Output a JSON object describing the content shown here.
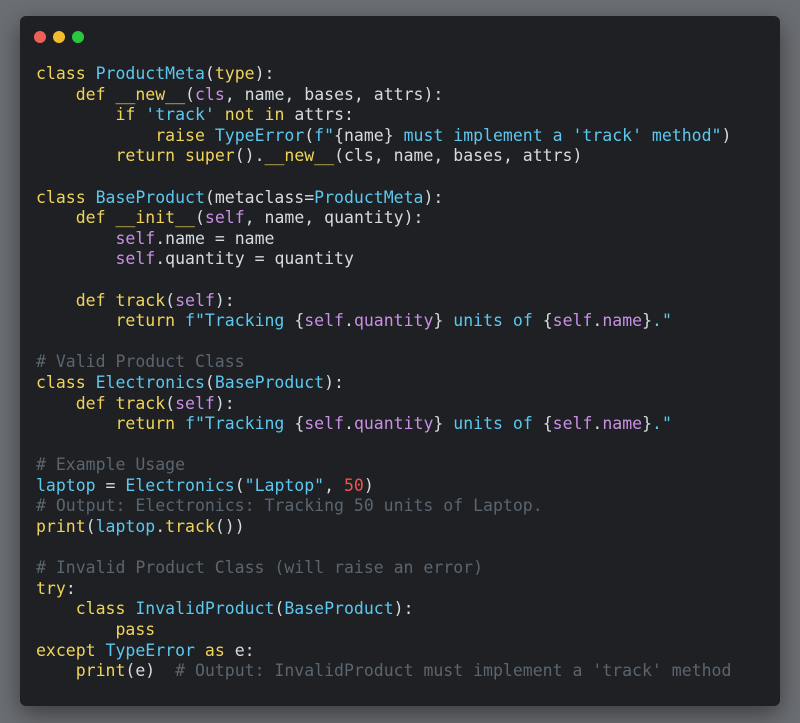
{
  "colors": {
    "background": "#6b6e73",
    "editor_bg": "#1e2023",
    "close": "#ee5f57",
    "minimize": "#f2bb2e",
    "maximize": "#28c840",
    "keyword": "#f0d45a",
    "class_name": "#5cc8f0",
    "function": "#f0d45a",
    "self": "#c990e6",
    "string": "#5cc8f0",
    "number": "#ef5350",
    "comment": "#5b6570",
    "plain": "#d6dbe0",
    "operator": "#7fd47a"
  },
  "window_controls": [
    {
      "name": "close-dot",
      "color": "#ee5f57"
    },
    {
      "name": "minimize-dot",
      "color": "#f2bb2e"
    },
    {
      "name": "maximize-dot",
      "color": "#28c840"
    }
  ],
  "code_lines": [
    [
      [
        "kw",
        "class"
      ],
      [
        "p",
        " "
      ],
      [
        "cls",
        "ProductMeta"
      ],
      [
        "p",
        "("
      ],
      [
        "kw",
        "type"
      ],
      [
        "p",
        "):"
      ]
    ],
    [
      [
        "p",
        "    "
      ],
      [
        "kw",
        "def"
      ],
      [
        "p",
        " "
      ],
      [
        "fn",
        "__new__"
      ],
      [
        "p",
        "("
      ],
      [
        "self",
        "cls"
      ],
      [
        "p",
        ", name, bases, attrs):"
      ]
    ],
    [
      [
        "p",
        "        "
      ],
      [
        "kw",
        "if"
      ],
      [
        "p",
        " "
      ],
      [
        "str",
        "'track'"
      ],
      [
        "p",
        " "
      ],
      [
        "kw",
        "not"
      ],
      [
        "p",
        " "
      ],
      [
        "kw",
        "in"
      ],
      [
        "p",
        " attrs:"
      ]
    ],
    [
      [
        "p",
        "            "
      ],
      [
        "kw",
        "raise"
      ],
      [
        "p",
        " "
      ],
      [
        "cls",
        "TypeError"
      ],
      [
        "p",
        "("
      ],
      [
        "str",
        "f\""
      ],
      [
        "p",
        "{name}"
      ],
      [
        "str",
        " must implement a 'track' method\""
      ],
      [
        "p",
        ")"
      ]
    ],
    [
      [
        "p",
        "        "
      ],
      [
        "kw",
        "return"
      ],
      [
        "p",
        " "
      ],
      [
        "fn",
        "super"
      ],
      [
        "p",
        "()."
      ],
      [
        "fn",
        "__new__"
      ],
      [
        "p",
        "(cls, name, bases, attrs)"
      ]
    ],
    [],
    [
      [
        "kw",
        "class"
      ],
      [
        "p",
        " "
      ],
      [
        "cls",
        "BaseProduct"
      ],
      [
        "p",
        "(metaclass="
      ],
      [
        "cls",
        "ProductMeta"
      ],
      [
        "p",
        "):"
      ]
    ],
    [
      [
        "p",
        "    "
      ],
      [
        "kw",
        "def"
      ],
      [
        "p",
        " "
      ],
      [
        "fn",
        "__init__"
      ],
      [
        "p",
        "("
      ],
      [
        "self",
        "self"
      ],
      [
        "p",
        ", name, quantity):"
      ]
    ],
    [
      [
        "p",
        "        "
      ],
      [
        "self",
        "self"
      ],
      [
        "p",
        ".name = name"
      ]
    ],
    [
      [
        "p",
        "        "
      ],
      [
        "self",
        "self"
      ],
      [
        "p",
        ".quantity = quantity"
      ]
    ],
    [],
    [
      [
        "p",
        "    "
      ],
      [
        "kw",
        "def"
      ],
      [
        "p",
        " "
      ],
      [
        "fn",
        "track"
      ],
      [
        "p",
        "("
      ],
      [
        "self",
        "self"
      ],
      [
        "p",
        "):"
      ]
    ],
    [
      [
        "p",
        "        "
      ],
      [
        "kw",
        "return"
      ],
      [
        "p",
        " "
      ],
      [
        "str",
        "f\"Tracking "
      ],
      [
        "p",
        "{"
      ],
      [
        "self",
        "self"
      ],
      [
        "p",
        "."
      ],
      [
        "self",
        "quantity"
      ],
      [
        "p",
        "}"
      ],
      [
        "str",
        " units of "
      ],
      [
        "p",
        "{"
      ],
      [
        "self",
        "self"
      ],
      [
        "p",
        "."
      ],
      [
        "self",
        "name"
      ],
      [
        "p",
        "}"
      ],
      [
        "str",
        ".\""
      ]
    ],
    [],
    [
      [
        "cm",
        "# Valid Product Class"
      ]
    ],
    [
      [
        "kw",
        "class"
      ],
      [
        "p",
        " "
      ],
      [
        "cls",
        "Electronics"
      ],
      [
        "p",
        "("
      ],
      [
        "cls",
        "BaseProduct"
      ],
      [
        "p",
        "):"
      ]
    ],
    [
      [
        "p",
        "    "
      ],
      [
        "kw",
        "def"
      ],
      [
        "p",
        " "
      ],
      [
        "fn",
        "track"
      ],
      [
        "p",
        "("
      ],
      [
        "self",
        "self"
      ],
      [
        "p",
        "):"
      ]
    ],
    [
      [
        "p",
        "        "
      ],
      [
        "kw",
        "return"
      ],
      [
        "p",
        " "
      ],
      [
        "str",
        "f\"Tracking "
      ],
      [
        "p",
        "{"
      ],
      [
        "self",
        "self"
      ],
      [
        "p",
        "."
      ],
      [
        "self",
        "quantity"
      ],
      [
        "p",
        "}"
      ],
      [
        "str",
        " units of "
      ],
      [
        "p",
        "{"
      ],
      [
        "self",
        "self"
      ],
      [
        "p",
        "."
      ],
      [
        "self",
        "name"
      ],
      [
        "p",
        "}"
      ],
      [
        "str",
        ".\""
      ]
    ],
    [],
    [
      [
        "cm",
        "# Example Usage"
      ]
    ],
    [
      [
        "cls",
        "laptop"
      ],
      [
        "p",
        " = "
      ],
      [
        "cls",
        "Electronics"
      ],
      [
        "p",
        "("
      ],
      [
        "str",
        "\"Laptop\""
      ],
      [
        "p",
        ", "
      ],
      [
        "num",
        "50"
      ],
      [
        "p",
        ")"
      ]
    ],
    [
      [
        "cm",
        "# Output: Electronics: Tracking 50 units of Laptop."
      ]
    ],
    [
      [
        "fn",
        "print"
      ],
      [
        "p",
        "("
      ],
      [
        "cls",
        "laptop"
      ],
      [
        "p",
        "."
      ],
      [
        "fn",
        "track"
      ],
      [
        "p",
        "())"
      ]
    ],
    [],
    [
      [
        "cm",
        "# Invalid Product Class (will raise an error)"
      ]
    ],
    [
      [
        "kw",
        "try"
      ],
      [
        "p",
        ":"
      ]
    ],
    [
      [
        "p",
        "    "
      ],
      [
        "kw",
        "class"
      ],
      [
        "p",
        " "
      ],
      [
        "cls",
        "InvalidProduct"
      ],
      [
        "p",
        "("
      ],
      [
        "cls",
        "BaseProduct"
      ],
      [
        "p",
        "):"
      ]
    ],
    [
      [
        "p",
        "        "
      ],
      [
        "kw",
        "pass"
      ]
    ],
    [
      [
        "kw",
        "except"
      ],
      [
        "p",
        " "
      ],
      [
        "cls",
        "TypeError"
      ],
      [
        "p",
        " "
      ],
      [
        "kw",
        "as"
      ],
      [
        "p",
        " e:"
      ]
    ],
    [
      [
        "p",
        "    "
      ],
      [
        "fn",
        "print"
      ],
      [
        "p",
        "(e)  "
      ],
      [
        "cm",
        "# Output: InvalidProduct must implement a 'track' method"
      ]
    ]
  ]
}
